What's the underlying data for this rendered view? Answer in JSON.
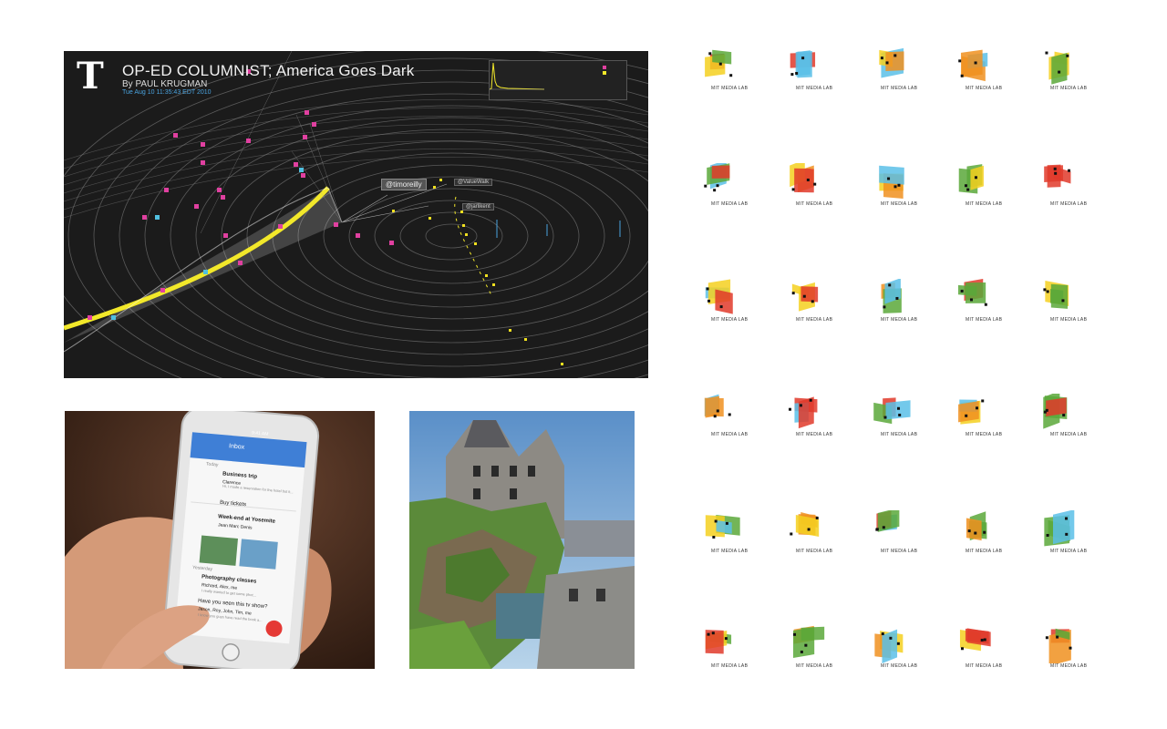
{
  "nyt": {
    "logo": "T",
    "title": "OP-ED COLUMNIST; America Goes Dark",
    "byline": "By PAUL KRUGMAN",
    "date": "Tue Aug 10 11:35:43 EDT 2010",
    "users": {
      "main": "@timoreilly",
      "second": "@ValueWalk",
      "third": "@jarlikent"
    },
    "colors": {
      "magenta": "#e040a0",
      "yellow": "#f0e020",
      "cyan": "#50c0e0"
    }
  },
  "phone": {
    "app_title": "Inbox",
    "time": "9:41 AM",
    "today": "Today",
    "items": [
      {
        "title": "Business trip",
        "sub": "Clarence",
        "body": "Hi, I made a reservation for the hotel but it..."
      },
      {
        "title": "Buy tickets",
        "sub": "",
        "body": ""
      },
      {
        "title": "Week-end at Yosemite",
        "sub": "Jean Marc Denis",
        "body": ""
      }
    ],
    "yesterday": "Yesterday",
    "items2": [
      {
        "title": "Photography classes",
        "sub": "Richard, Alex, me",
        "body": "I really wanted to get some phot..."
      },
      {
        "title": "Have you seen this tv show?",
        "sub": "Jason, Roy, John, Tim, me",
        "body": "I know you guys have read the book a..."
      }
    ]
  },
  "logos": {
    "label": "MIT MEDIA LAB",
    "colors": {
      "green": "#5aa83a",
      "blue": "#5ac0e8",
      "red": "#e03a2a",
      "yellow": "#f5d020",
      "orange": "#f09020",
      "black": "#111111"
    }
  }
}
